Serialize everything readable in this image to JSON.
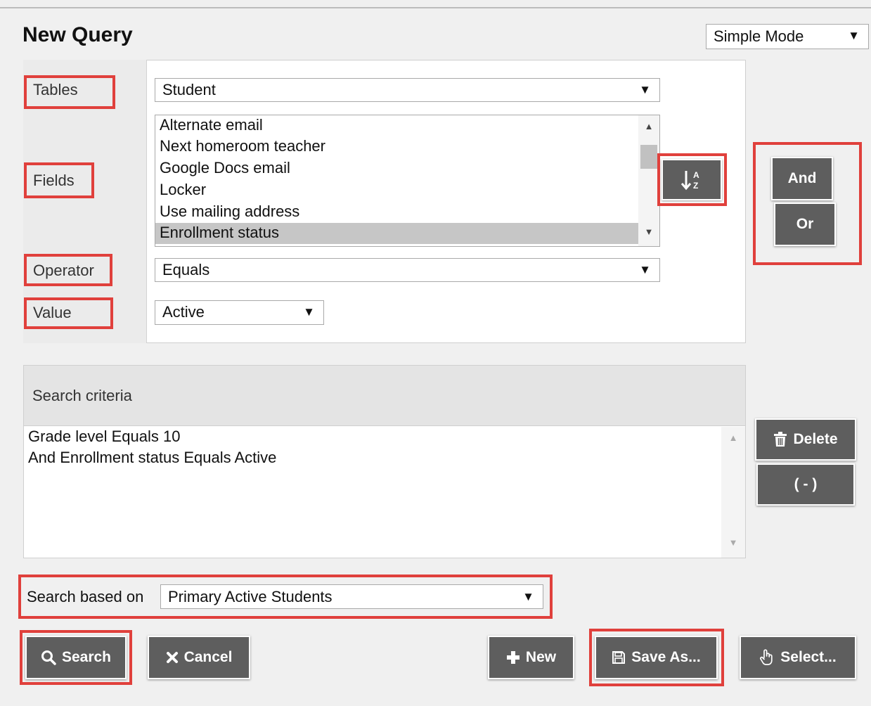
{
  "page": {
    "title": "New Query"
  },
  "mode": {
    "selected": "Simple Mode"
  },
  "query_builder": {
    "labels": {
      "tables": "Tables",
      "fields": "Fields",
      "operator": "Operator",
      "value": "Value"
    },
    "tables_value": "Student",
    "fields": [
      {
        "label": "Alternate email",
        "selected": false
      },
      {
        "label": "Next homeroom teacher",
        "selected": false
      },
      {
        "label": "Google Docs email",
        "selected": false
      },
      {
        "label": "Locker",
        "selected": false
      },
      {
        "label": "Use mailing address",
        "selected": false
      },
      {
        "label": "Enrollment status",
        "selected": true
      }
    ],
    "operator_value": "Equals",
    "value_value": "Active",
    "sort_icon": "sort-alpha-icon"
  },
  "logic_buttons": {
    "and_label": "And",
    "or_label": "Or"
  },
  "criteria": {
    "header": "Search criteria",
    "lines": [
      "Grade level Equals 10",
      "And Enrollment status Equals Active"
    ]
  },
  "criteria_buttons": {
    "delete_label": "Delete",
    "paren_label": "( - )"
  },
  "search_based_on": {
    "label": "Search based on",
    "value": "Primary Active Students"
  },
  "footer_buttons": {
    "search": "Search",
    "cancel": "Cancel",
    "new": "New",
    "save_as": "Save As...",
    "select": "Select..."
  },
  "colors": {
    "highlight": "#e0403c",
    "button_bg": "#5e5e5e",
    "selected_row": "#c6c6c6"
  }
}
